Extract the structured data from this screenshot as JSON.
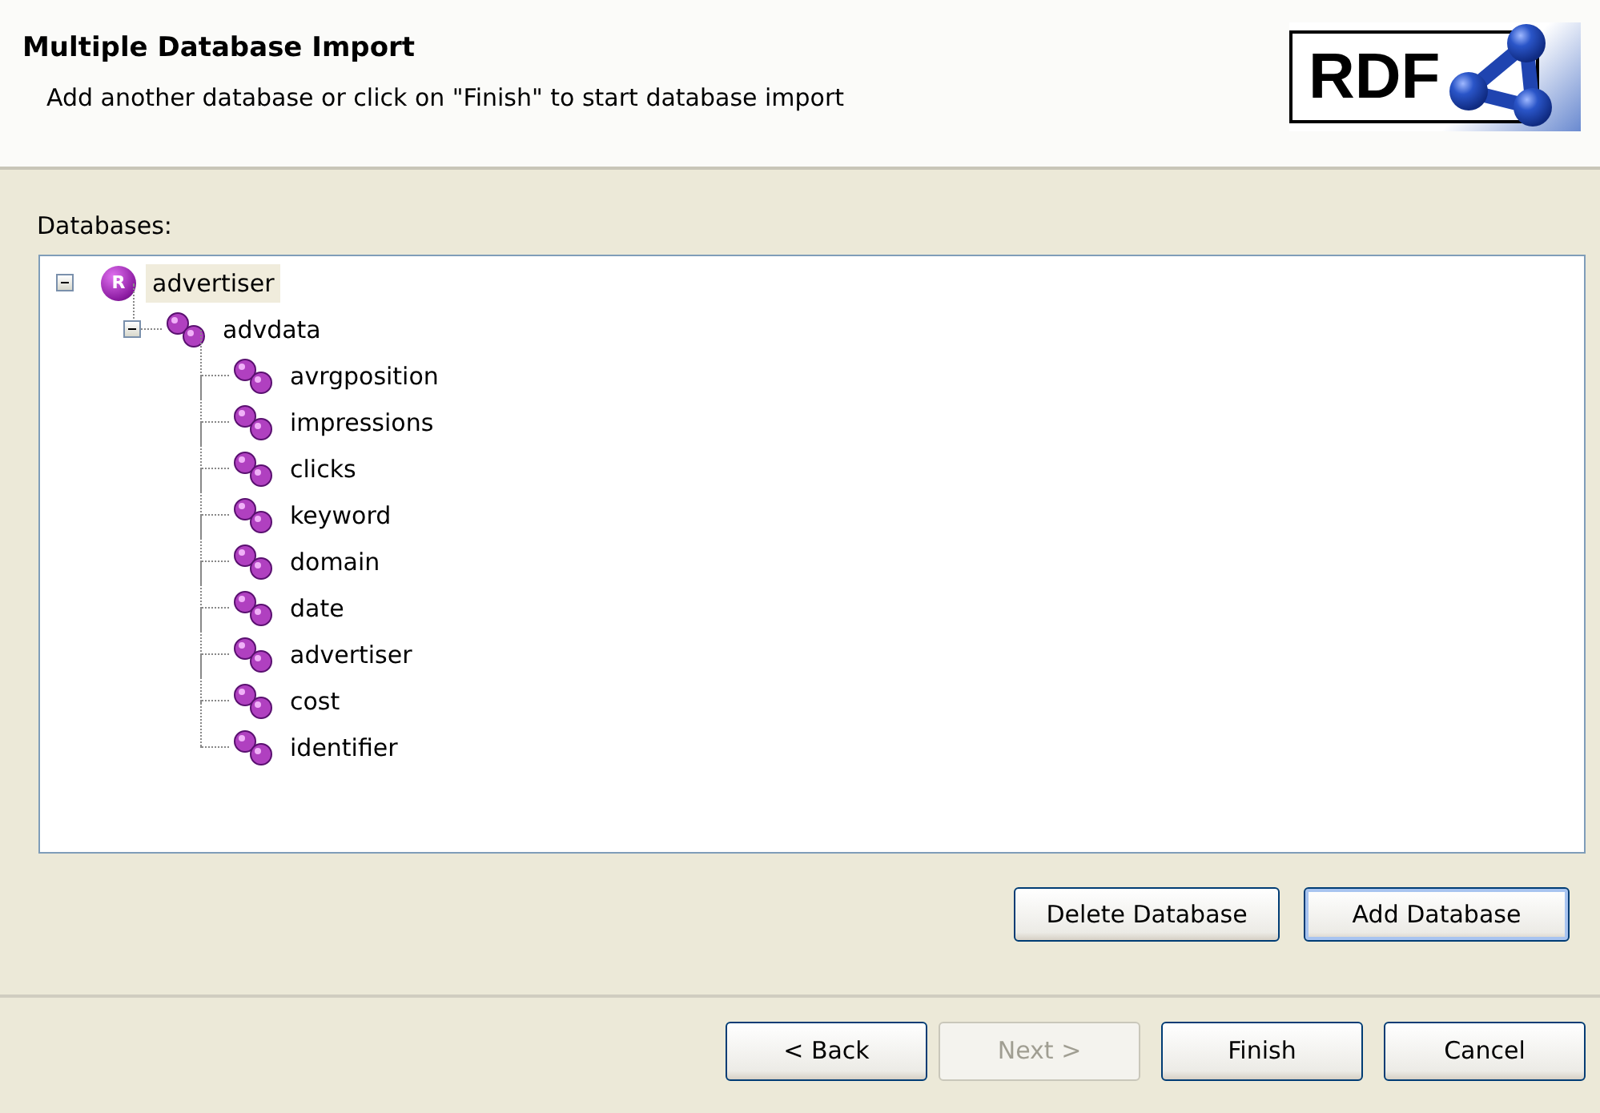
{
  "header": {
    "title": "Multiple Database Import",
    "subtitle": "Add another database or click on \"Finish\" to start database import",
    "logo_text": "RDF"
  },
  "tree_label": "Databases:",
  "tree": [
    {
      "label": "advertiser",
      "kind": "database",
      "icon_letter": "R",
      "expanded": true,
      "selected": true,
      "children": [
        {
          "label": "advdata",
          "kind": "table",
          "expanded": true,
          "selected": false,
          "children": [
            {
              "label": "avrgposition",
              "kind": "column",
              "selected": false
            },
            {
              "label": "impressions",
              "kind": "column",
              "selected": false
            },
            {
              "label": "clicks",
              "kind": "column",
              "selected": false
            },
            {
              "label": "keyword",
              "kind": "column",
              "selected": false
            },
            {
              "label": "domain",
              "kind": "column",
              "selected": false
            },
            {
              "label": "date",
              "kind": "column",
              "selected": false
            },
            {
              "label": "advertiser",
              "kind": "column",
              "selected": false
            },
            {
              "label": "cost",
              "kind": "column",
              "selected": false
            },
            {
              "label": "identifier",
              "kind": "column",
              "selected": false
            }
          ]
        }
      ]
    }
  ],
  "tree_buttons": [
    {
      "label": "Delete Database",
      "default": false,
      "disabled": false
    },
    {
      "label": "Add Database",
      "default": true,
      "disabled": false
    }
  ],
  "wizard_buttons": [
    {
      "label": "< Back",
      "default": false,
      "disabled": false
    },
    {
      "label": "Next >",
      "default": false,
      "disabled": true
    },
    {
      "label": "Finish",
      "default": false,
      "disabled": false
    },
    {
      "label": "Cancel",
      "default": false,
      "disabled": false
    }
  ]
}
